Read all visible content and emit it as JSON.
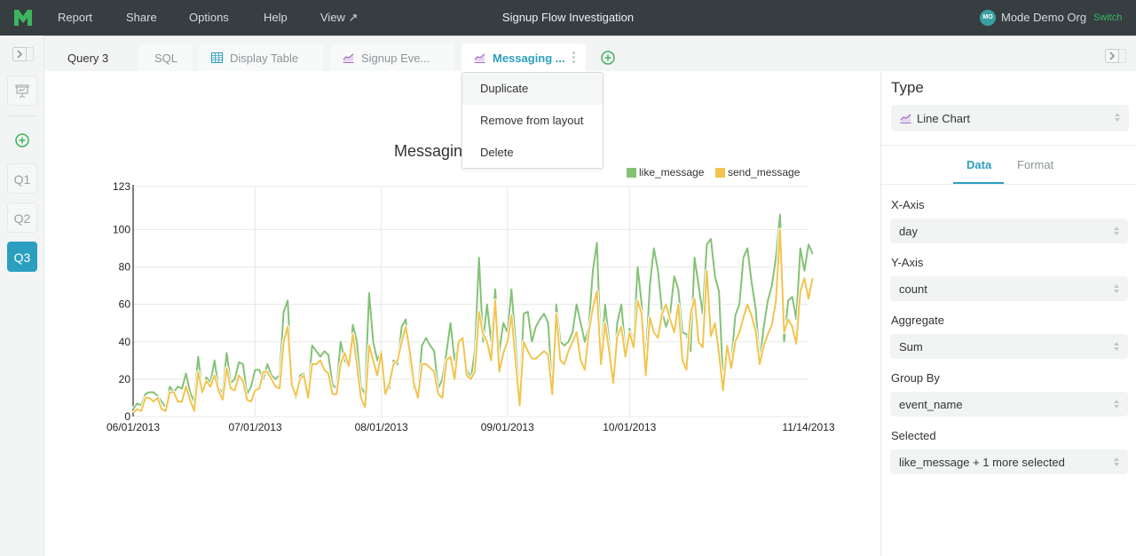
{
  "topbar": {
    "nav": [
      "Report",
      "Share",
      "Options",
      "Help",
      "View ↗"
    ],
    "title": "Signup Flow Investigation",
    "avatar_initials": "MO",
    "org_name": "Mode Demo Org",
    "switch_label": "Switch"
  },
  "leftrail": {
    "queries": [
      "Q1",
      "Q2",
      "Q3"
    ],
    "active_query": "Q3"
  },
  "tabs": {
    "query_label": "Query 3",
    "items": [
      {
        "label": "SQL",
        "icon": "none"
      },
      {
        "label": "Display Table",
        "icon": "table-icon"
      },
      {
        "label": "Signup Eve...",
        "icon": "line-chart-icon"
      },
      {
        "label": "Messaging ...",
        "icon": "line-chart-icon",
        "active": true
      }
    ]
  },
  "context_menu": {
    "items": [
      "Duplicate",
      "Remove from layout",
      "Delete"
    ],
    "hovered": "Duplicate"
  },
  "sidepanel": {
    "type_heading": "Type",
    "type_value": "Line Chart",
    "tabs": [
      "Data",
      "Format"
    ],
    "active_tab": "Data",
    "fields": [
      {
        "label": "X-Axis",
        "value": "day"
      },
      {
        "label": "Y-Axis",
        "value": "count"
      },
      {
        "label": "Aggregate",
        "value": "Sum"
      },
      {
        "label": "Group By",
        "value": "event_name"
      },
      {
        "label": "Selected",
        "value": "like_message + 1 more selected"
      }
    ]
  },
  "colors": {
    "accent": "#2b9fbf",
    "like_message": "#84c276",
    "send_message": "#f2c44f",
    "brand_green": "#3cb55e",
    "topbar": "#363e42"
  },
  "chart_data": {
    "type": "line",
    "title": "Messaging",
    "xlabel": "",
    "ylabel": "",
    "x_range": [
      "06/01/2013",
      "11/14/2013"
    ],
    "x_ticks": [
      {
        "label": "06/01/2013",
        "day": 0
      },
      {
        "label": "07/01/2013",
        "day": 30
      },
      {
        "label": "08/01/2013",
        "day": 61
      },
      {
        "label": "09/01/2013",
        "day": 92
      },
      {
        "label": "10/01/2013",
        "day": 122
      },
      {
        "label": "11/14/2013",
        "day": 166
      }
    ],
    "ylim": [
      0,
      123
    ],
    "y_ticks": [
      0,
      20,
      40,
      60,
      80,
      100,
      123
    ],
    "grid": true,
    "legend_position": "top-right",
    "series": [
      {
        "name": "like_message",
        "values": [
          4,
          7,
          6,
          12,
          13,
          13,
          11,
          8,
          5,
          16,
          13,
          16,
          15,
          23,
          13,
          8,
          32,
          13,
          21,
          18,
          30,
          15,
          13,
          34,
          18,
          20,
          29,
          28,
          12,
          16,
          25,
          25,
          20,
          28,
          22,
          20,
          22,
          56,
          62,
          18,
          10,
          22,
          23,
          12,
          38,
          35,
          32,
          35,
          33,
          17,
          15,
          40,
          30,
          27,
          49,
          40,
          16,
          12,
          66,
          40,
          30,
          35,
          15,
          15,
          30,
          28,
          48,
          52,
          30,
          15,
          12,
          38,
          42,
          38,
          35,
          15,
          20,
          34,
          50,
          30,
          40,
          40,
          26,
          20,
          35,
          85,
          40,
          60,
          40,
          68,
          35,
          50,
          45,
          68,
          40,
          10,
          55,
          56,
          40,
          48,
          52,
          55,
          50,
          15,
          60,
          40,
          38,
          40,
          45,
          60,
          50,
          40,
          48,
          78,
          93,
          32,
          60,
          40,
          20,
          50,
          60,
          35,
          47,
          40,
          80,
          60,
          30,
          70,
          90,
          78,
          56,
          48,
          55,
          75,
          68,
          45,
          44,
          35,
          85,
          70,
          55,
          92,
          95,
          75,
          67,
          20,
          38,
          28,
          54,
          60,
          85,
          90,
          72,
          58,
          30,
          48,
          62,
          70,
          85,
          108,
          40,
          62,
          64,
          52,
          90,
          78,
          92,
          87
        ],
        "color": "#84c276"
      },
      {
        "name": "send_message",
        "values": [
          2,
          4,
          3,
          10,
          10,
          8,
          10,
          4,
          3,
          13,
          13,
          8,
          8,
          16,
          9,
          3,
          24,
          13,
          19,
          16,
          22,
          14,
          9,
          26,
          15,
          14,
          22,
          19,
          9,
          8,
          14,
          15,
          24,
          24,
          20,
          16,
          15,
          40,
          48,
          17,
          11,
          20,
          22,
          10,
          28,
          28,
          30,
          25,
          23,
          12,
          12,
          28,
          34,
          27,
          44,
          28,
          10,
          5,
          38,
          30,
          22,
          34,
          12,
          18,
          28,
          30,
          40,
          48,
          35,
          18,
          10,
          28,
          28,
          26,
          24,
          12,
          10,
          30,
          32,
          20,
          40,
          42,
          22,
          20,
          24,
          56,
          44,
          40,
          30,
          62,
          24,
          34,
          40,
          54,
          30,
          6,
          40,
          35,
          31,
          31,
          33,
          35,
          33,
          12,
          55,
          30,
          28,
          35,
          40,
          45,
          30,
          25,
          45,
          58,
          67,
          28,
          50,
          35,
          18,
          43,
          48,
          32,
          45,
          37,
          62,
          55,
          22,
          53,
          45,
          42,
          55,
          60,
          52,
          45,
          60,
          30,
          25,
          55,
          63,
          40,
          37,
          78,
          43,
          50,
          34,
          14,
          38,
          26,
          40,
          45,
          53,
          60,
          54,
          46,
          28,
          38,
          44,
          49,
          62,
          100,
          45,
          52,
          48,
          39,
          67,
          74,
          63,
          74
        ],
        "color": "#f2c44f"
      }
    ]
  }
}
